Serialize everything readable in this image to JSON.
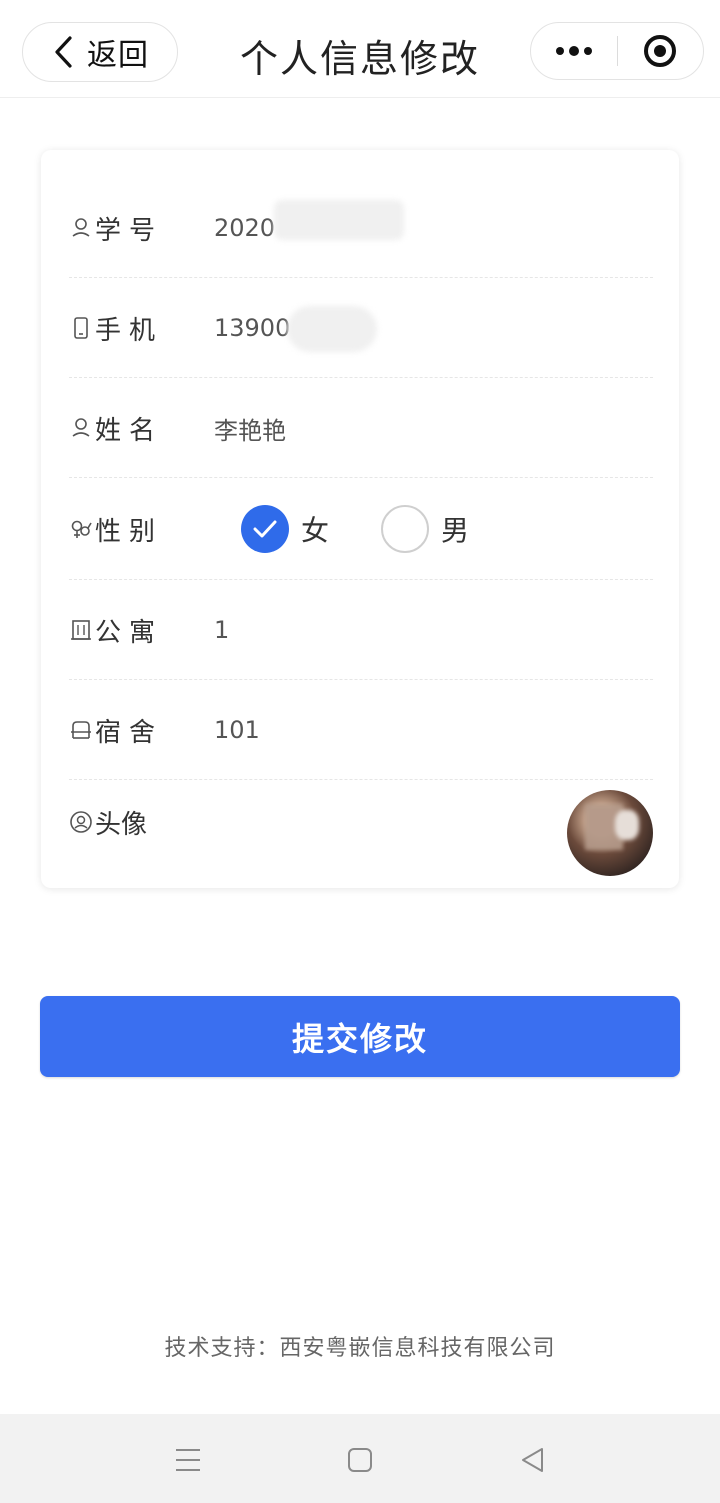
{
  "header": {
    "back_label": "返回",
    "title": "个人信息修改",
    "more_icon": "more-dots-icon",
    "target_icon": "target-circle-icon"
  },
  "form": {
    "rows": [
      {
        "label": "学号",
        "icon": "person-icon",
        "value": "2020"
      },
      {
        "label": "手机",
        "icon": "phone-icon",
        "value": "13900"
      },
      {
        "label": "姓名",
        "icon": "person-icon",
        "value": "李艳艳"
      },
      {
        "label": "性别",
        "icon": "gender-icon"
      },
      {
        "label": "公寓",
        "icon": "building-icon",
        "value": "1"
      },
      {
        "label": "宿舍",
        "icon": "bed-icon",
        "value": "101"
      },
      {
        "label": "头像",
        "icon": "avatar-icon"
      }
    ],
    "gender": {
      "options": [
        "女",
        "男"
      ],
      "selected": "女"
    }
  },
  "submit_label": "提交修改",
  "footer_text": "技术支持：西安粤嵌信息科技有限公司",
  "colors": {
    "accent": "#3a6ff0",
    "radio_checked": "#2f6bea"
  }
}
